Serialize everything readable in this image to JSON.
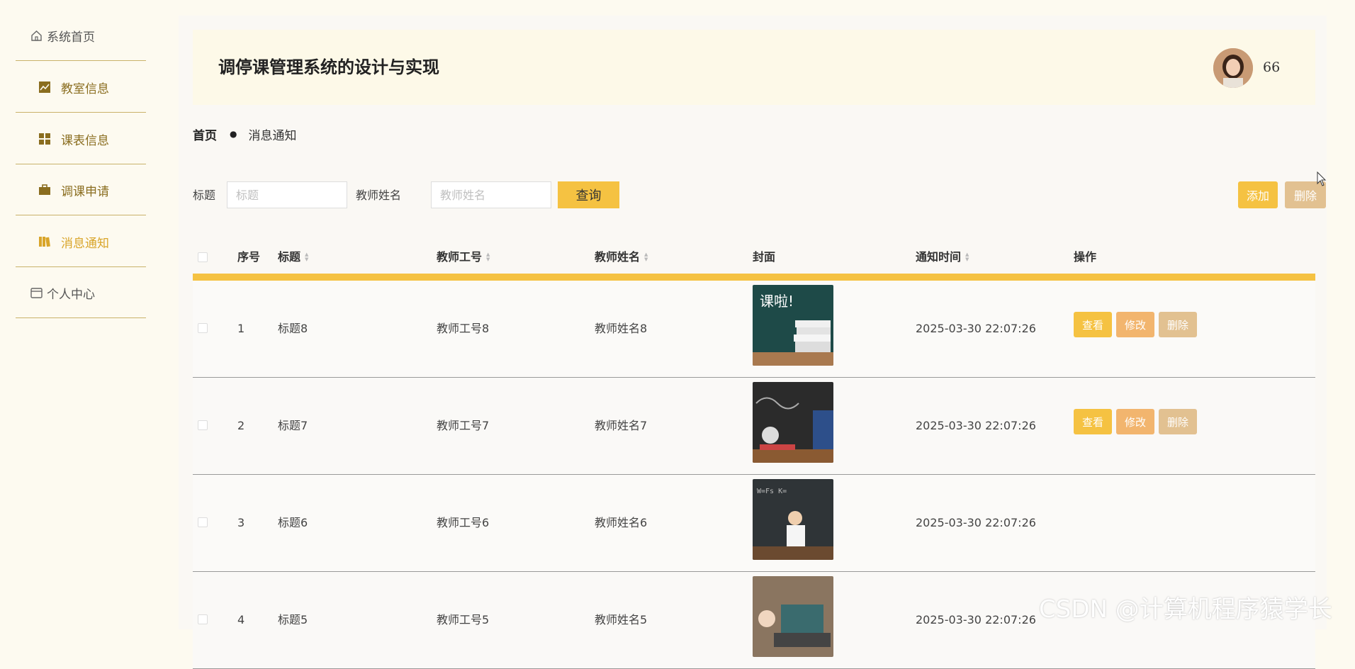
{
  "sidebar": {
    "items": [
      {
        "label": "系统首页",
        "icon": "home-icon"
      },
      {
        "label": "教室信息",
        "icon": "chart-icon"
      },
      {
        "label": "课表信息",
        "icon": "grid-icon"
      },
      {
        "label": "调课申请",
        "icon": "briefcase-icon"
      },
      {
        "label": "消息通知",
        "icon": "book-icon"
      },
      {
        "label": "个人中心",
        "icon": "card-icon"
      }
    ]
  },
  "header": {
    "title": "调停课管理系统的设计与实现",
    "username": "66"
  },
  "breadcrumb": {
    "home": "首页",
    "current": "消息通知"
  },
  "search": {
    "title_label": "标题",
    "title_placeholder": "标题",
    "teacher_label": "教师姓名",
    "teacher_placeholder": "教师姓名",
    "query_label": "查询",
    "add_label": "添加",
    "delete_label": "删除"
  },
  "table": {
    "headers": {
      "index": "序号",
      "title": "标题",
      "teacher_no": "教师工号",
      "teacher_name": "教师姓名",
      "cover": "封面",
      "notice_time": "通知时间",
      "actions": "操作"
    },
    "action_labels": {
      "view": "查看",
      "edit": "修改",
      "delete": "删除"
    },
    "rows": [
      {
        "index": "1",
        "title": "标题8",
        "teacher_no": "教师工号8",
        "teacher_name": "教师姓名8",
        "notice_time": "2025-03-30 22:07:26"
      },
      {
        "index": "2",
        "title": "标题7",
        "teacher_no": "教师工号7",
        "teacher_name": "教师姓名7",
        "notice_time": "2025-03-30 22:07:26"
      },
      {
        "index": "3",
        "title": "标题6",
        "teacher_no": "教师工号6",
        "teacher_name": "教师姓名6",
        "notice_time": "2025-03-30 22:07:26"
      },
      {
        "index": "4",
        "title": "标题5",
        "teacher_no": "教师工号5",
        "teacher_name": "教师姓名5",
        "notice_time": "2025-03-30 22:07:26"
      }
    ]
  },
  "watermark": "CSDN @计算机程序猿学长",
  "colors": {
    "accent": "#f5c242",
    "edit": "#f2b56e",
    "muted": "#e2c191",
    "sidebar_text": "#8a6d1f"
  }
}
